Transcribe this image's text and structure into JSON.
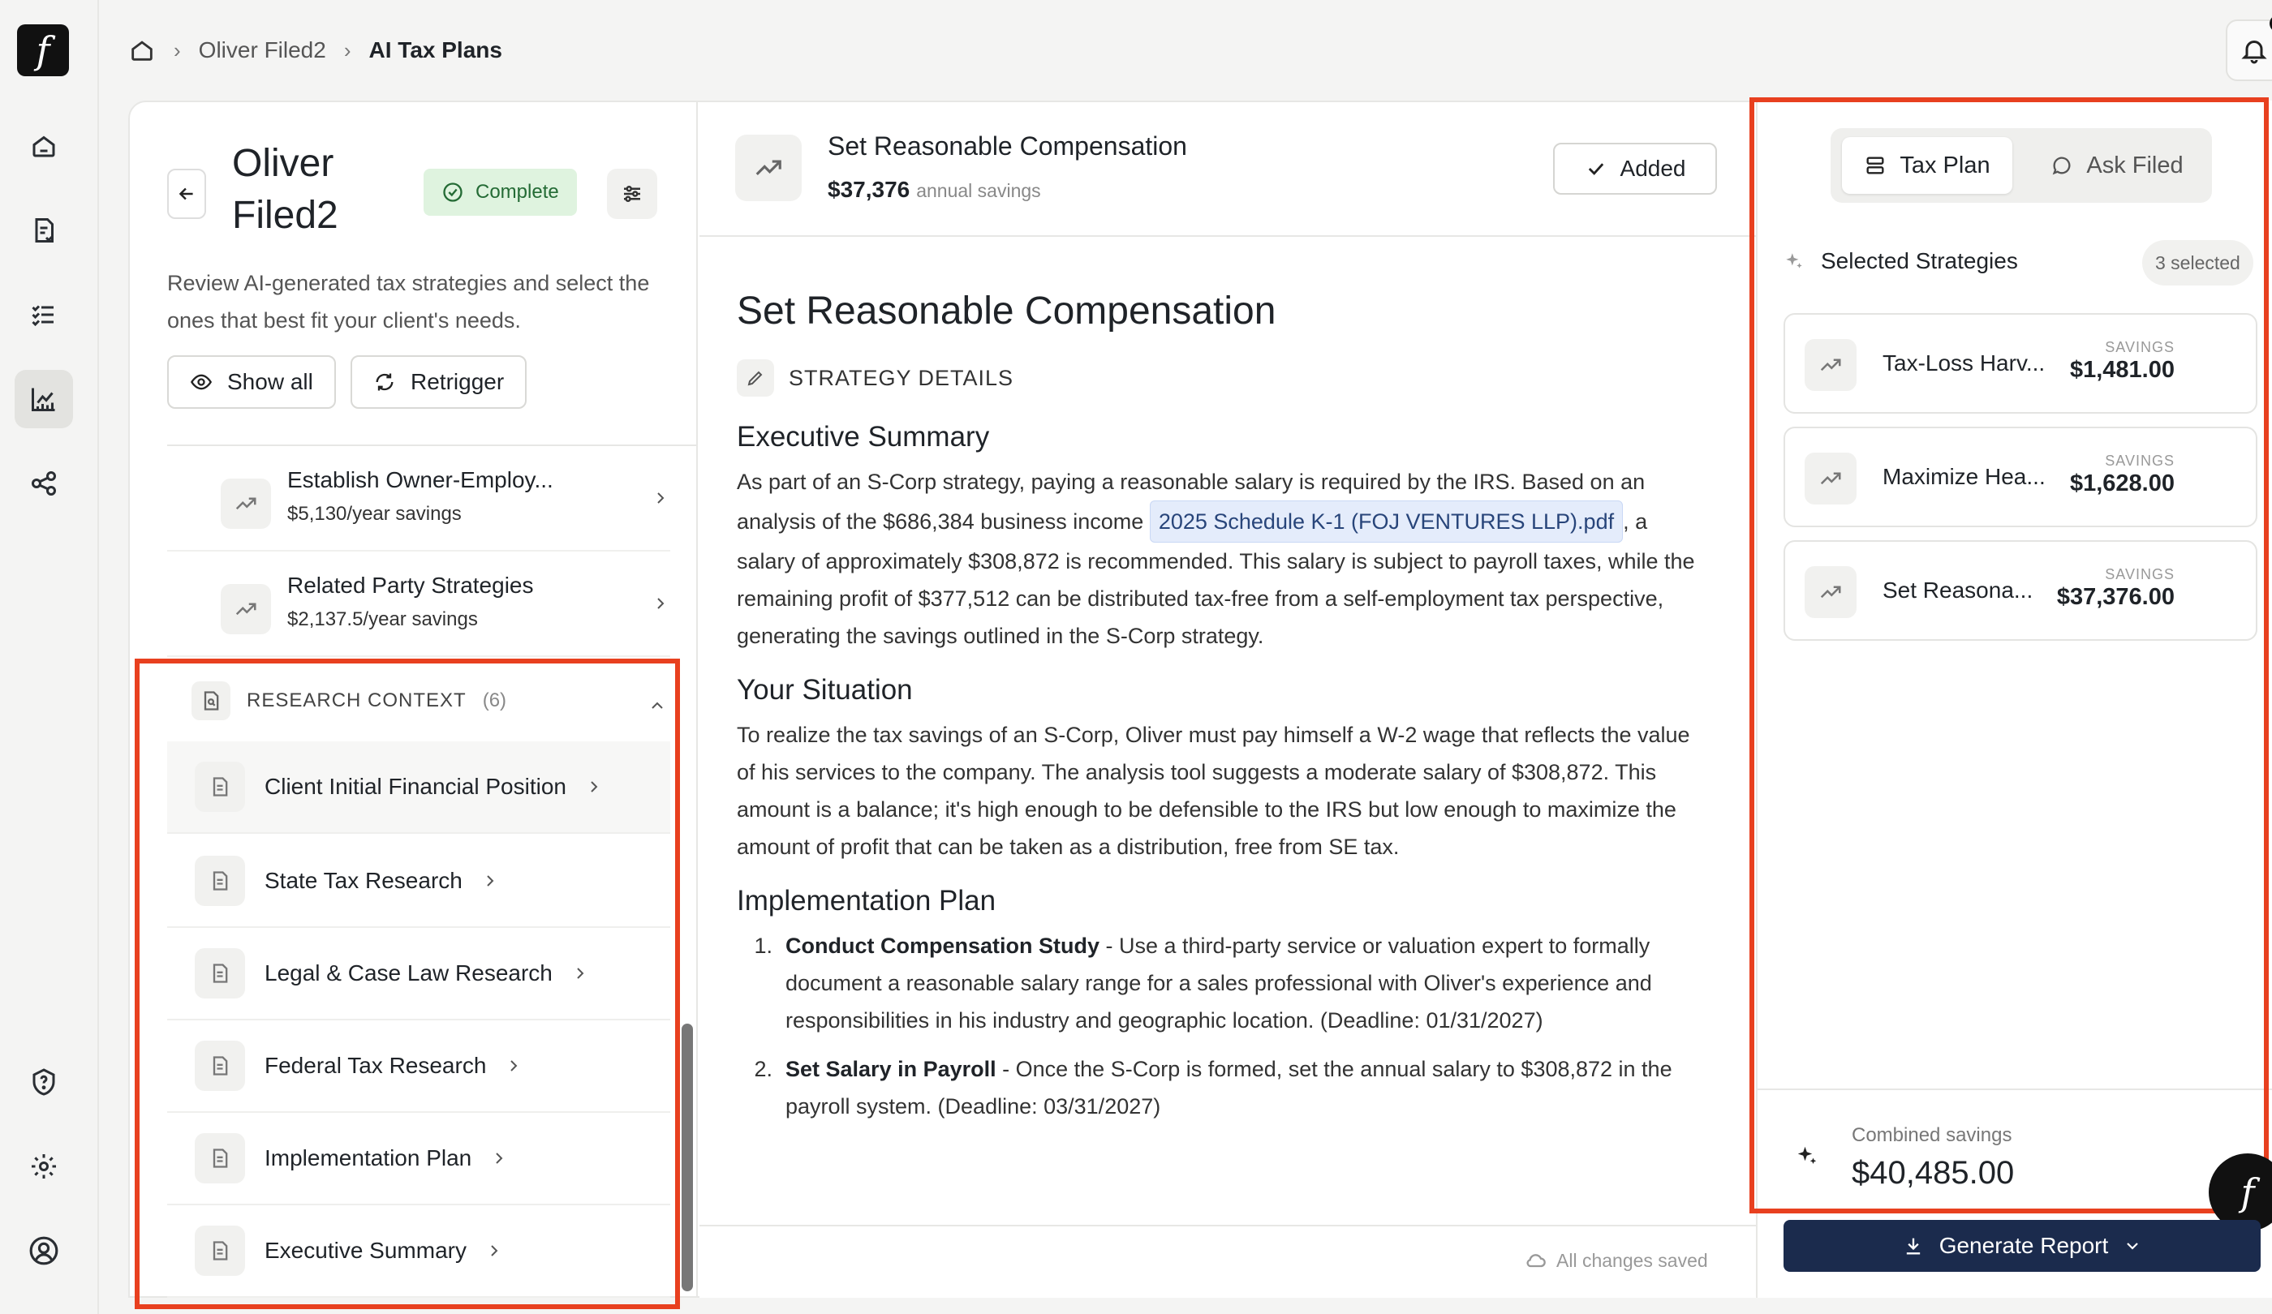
{
  "app": {
    "logo_glyph": "f"
  },
  "rail": {
    "items": [
      {
        "icon": "home-icon"
      },
      {
        "icon": "document-icon"
      },
      {
        "icon": "checklist-icon"
      },
      {
        "icon": "chart-icon",
        "active": true
      },
      {
        "icon": "share-icon"
      },
      {
        "icon": "help-icon"
      },
      {
        "icon": "gear-icon"
      },
      {
        "icon": "user-icon"
      }
    ]
  },
  "breadcrumb": {
    "items": [
      "Oliver Filed2",
      "AI Tax Plans"
    ]
  },
  "client": {
    "name": "Oliver Filed2",
    "status": "Complete",
    "description": "Review AI-generated tax strategies and select the ones that best fit your client's needs.",
    "show_all_label": "Show all",
    "retrigger_label": "Retrigger"
  },
  "strategies": [
    {
      "title": "Establish Owner-Employ...",
      "savings": "$5,130/year savings"
    },
    {
      "title": "Related Party Strategies",
      "savings": "$2,137.5/year savings"
    }
  ],
  "research_context": {
    "title": "RESEARCH CONTEXT",
    "count": "(6)",
    "items": [
      "Client Initial Financial Position",
      "State Tax Research",
      "Legal & Case Law Research",
      "Federal Tax Research",
      "Implementation Plan",
      "Executive Summary"
    ]
  },
  "detail": {
    "header_title": "Set Reasonable Compensation",
    "header_savings": "$37,376",
    "header_savings_label": "annual savings",
    "added_label": "Added",
    "title": "Set Reasonable Compensation",
    "section_label": "STRATEGY DETAILS",
    "exec_heading": "Executive Summary",
    "exec_p1": "As part of an S-Corp strategy, paying a reasonable salary is required by the IRS. Based on an analysis of the $686,384 business income ",
    "exec_file": "2025 Schedule K-1 (FOJ VENTURES LLP).pdf",
    "exec_p2": ", a salary of approximately $308,872 is recommended. This salary is subject to payroll taxes, while the remaining profit of $377,512 can be distributed tax-free from a self-employment tax perspective, generating the savings outlined in the S-Corp strategy.",
    "situation_heading": "Your Situation",
    "situation_p": "To realize the tax savings of an S-Corp, Oliver must pay himself a W-2 wage that reflects the value of his services to the company. The analysis tool suggests a moderate salary of $308,872. This amount is a balance; it's high enough to be defensible to the IRS but low enough to maximize the amount of profit that can be taken as a distribution, free from SE tax.",
    "impl_heading": "Implementation Plan",
    "impl_steps": [
      {
        "num": "1.",
        "title": "Conduct Compensation Study",
        "text": " - Use a third-party service or valuation expert to formally document a reasonable salary range for a sales professional with Oliver's experience and responsibilities in his industry and geographic location. (Deadline: 01/31/2027)"
      },
      {
        "num": "2.",
        "title": "Set Salary in Payroll",
        "text": " - Once the S-Corp is formed, set the annual salary to $308,872 in the payroll system. (Deadline: 03/31/2027)"
      }
    ],
    "saved_status": "All changes saved"
  },
  "right_panel": {
    "tabs": [
      {
        "label": "Tax Plan",
        "icon": "layers-icon",
        "selected": true
      },
      {
        "label": "Ask Filed",
        "icon": "chat-bubble-icon",
        "selected": false
      }
    ],
    "selected_heading": "Selected Strategies",
    "selected_count": "3 selected",
    "savings_label": "SAVINGS",
    "cards": [
      {
        "title": "Tax-Loss Harv...",
        "savings": "$1,481.00"
      },
      {
        "title": "Maximize Hea...",
        "savings": "$1,628.00"
      },
      {
        "title": "Set Reasona...",
        "savings": "$37,376.00"
      }
    ],
    "combined_label": "Combined savings",
    "combined_value": "$40,485.00",
    "generate_label": "Generate Report"
  },
  "colors": {
    "highlight": "#e8401f",
    "primary_button": "#1b2b4d",
    "complete_badge": "#dff3df"
  }
}
